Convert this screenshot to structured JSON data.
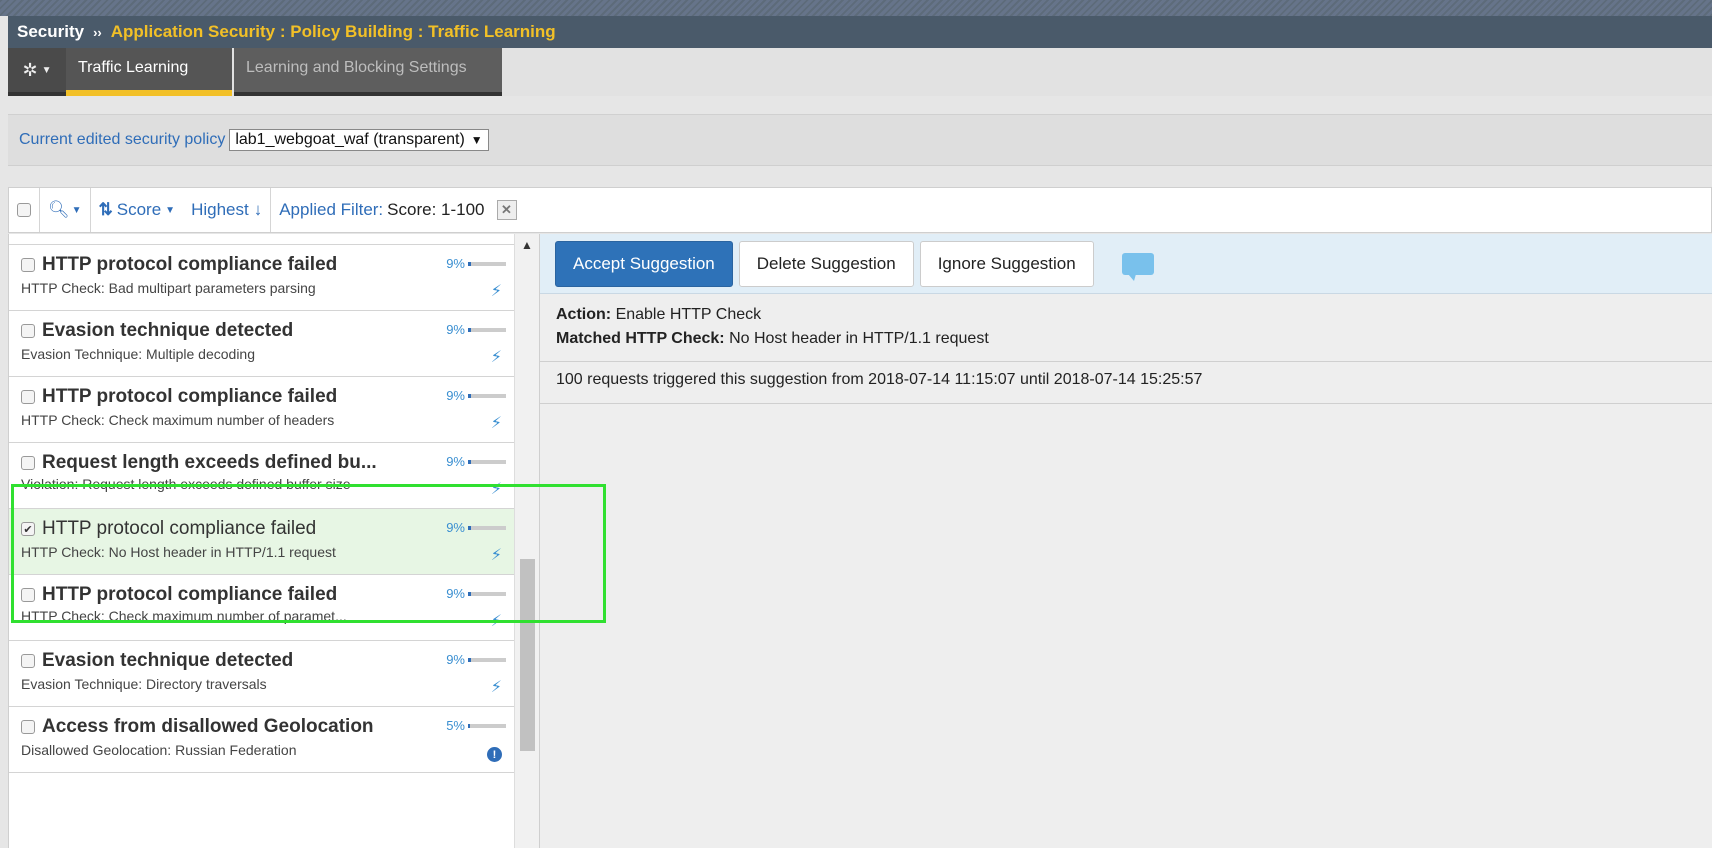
{
  "breadcrumb": {
    "root": "Security",
    "separator": "››",
    "path": "Application Security : Policy Building : Traffic Learning"
  },
  "tabs": [
    {
      "label": "Traffic Learning",
      "active": true
    },
    {
      "label": "Learning and Blocking Settings",
      "active": false
    }
  ],
  "policy": {
    "label": "Current edited security policy",
    "selected": "lab1_webgoat_waf (transparent)"
  },
  "toolbar": {
    "sort_label": "Score",
    "order_label": "Highest",
    "filter_label": "Applied Filter:",
    "filter_value": "Score: 1-100"
  },
  "suggestions": [
    {
      "title": "HTTP protocol compliance failed",
      "subtitle": "HTTP Check: Bad multipart parameters parsing",
      "score": "9%",
      "score_value": 9,
      "icon": "bolt-icon",
      "checked": false
    },
    {
      "title": "Evasion technique detected",
      "subtitle": "Evasion Technique: Multiple decoding",
      "score": "9%",
      "score_value": 9,
      "icon": "bolt-icon",
      "checked": false
    },
    {
      "title": "HTTP protocol compliance failed",
      "subtitle": "HTTP Check: Check maximum number of headers",
      "score": "9%",
      "score_value": 9,
      "icon": "bolt-icon",
      "checked": false
    },
    {
      "title": "Request length exceeds defined bu...",
      "subtitle": "Violation: Request length exceeds defined buffer size",
      "score": "9%",
      "score_value": 9,
      "icon": "bolt-icon",
      "checked": false
    },
    {
      "title": "HTTP protocol compliance failed",
      "subtitle": "HTTP Check: No Host header in HTTP/1.1 request",
      "score": "9%",
      "score_value": 9,
      "icon": "bolt-icon",
      "checked": true
    },
    {
      "title": "HTTP protocol compliance failed",
      "subtitle": "HTTP Check: Check maximum number of paramet...",
      "score": "9%",
      "score_value": 9,
      "icon": "bolt-icon",
      "checked": false
    },
    {
      "title": "Evasion technique detected",
      "subtitle": "Evasion Technique: Directory traversals",
      "score": "9%",
      "score_value": 9,
      "icon": "bolt-icon",
      "checked": false
    },
    {
      "title": "Access from disallowed Geolocation",
      "subtitle": "Disallowed Geolocation: Russian Federation",
      "score": "5%",
      "score_value": 5,
      "icon": "info-icon",
      "checked": false
    }
  ],
  "actions": {
    "accept": "Accept Suggestion",
    "delete": "Delete Suggestion",
    "ignore": "Ignore Suggestion"
  },
  "detail": {
    "action_label": "Action:",
    "action_value": "Enable HTTP Check",
    "check_label": "Matched HTTP Check:",
    "check_value": "No Host header in HTTP/1.1 request",
    "summary": "100 requests triggered this suggestion from 2018-07-14 11:15:07 until 2018-07-14 15:25:57"
  },
  "colors": {
    "accent": "#f2c027",
    "primary": "#2e72b8",
    "highlight": "#30e030"
  }
}
